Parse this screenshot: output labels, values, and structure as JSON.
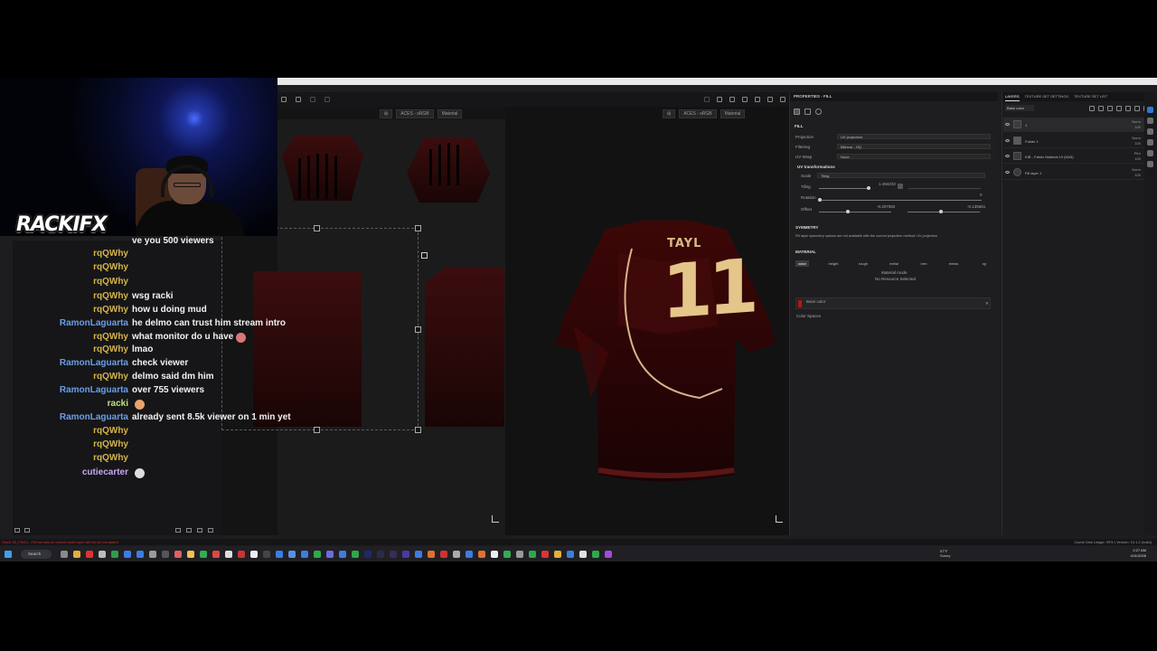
{
  "app": {
    "viewports": {
      "left": {
        "colorspace": "ACES - sRGB",
        "mode": "Material"
      },
      "right": {
        "colorspace": "ACES - sRGB",
        "mode": "Material"
      }
    },
    "properties": {
      "title": "PROPERTIES - FILL",
      "section_fill": "FILL",
      "projection_label": "Projection",
      "projection_value": "UV projection",
      "filtering_label": "Filtering",
      "filtering_value": "Bilinear - HQ",
      "uvwrap_label": "UV Wrap",
      "uvwrap_value": "None",
      "uvtrans_label": "UV transformations",
      "scale_label": "Scale",
      "scale_value": "Tiling",
      "tiling_label": "Tiling",
      "tiling_value": "1.494233",
      "rotation_label": "Rotation",
      "rotation_value": "0",
      "offset_label": "Offset",
      "offset_x": "-0.207082",
      "offset_y": "-0.135661",
      "symmetry_label": "SYMMETRY",
      "symmetry_note": "Fill layer symmetry options are not available with the current projection method: UV projection",
      "material_label": "MATERIAL",
      "channels": [
        "color",
        "height",
        "rough",
        "metal",
        "nrm",
        "emiss",
        "op"
      ],
      "material_mode_label": "Material mode",
      "material_mode_value": "No Resource Selected",
      "base_color_label": "Base color",
      "color_spaces_label": "Color Spaces"
    },
    "layers": {
      "tabs": [
        "LAYERS",
        "TEXTURE SET SETTINGS",
        "TEXTURE SET LIST"
      ],
      "blend_dropdown": "Base color",
      "items": [
        {
          "name": "1",
          "blend": "Norm",
          "opacity": "100"
        },
        {
          "name": "Folder 1",
          "blend": "Norm",
          "opacity": "100"
        },
        {
          "name": "KIB - Fabric Material 19 (M43)",
          "blend": "Pthr",
          "opacity": "100"
        },
        {
          "name": "Fill layer 1",
          "blend": "Norm",
          "opacity": "100"
        }
      ]
    },
    "status": {
      "error": "Stack 1B_FW13 - Fill normals on mixed mode layer will not be computed",
      "version": "Cache Disk Usage: 99% | Version: 10.1.2 (build)"
    }
  },
  "taskbar": {
    "search": "Search",
    "weather_temp": "57°F",
    "weather_desc": "Sunny",
    "time": "2:27 AM",
    "date": "4/11/2026"
  },
  "overlay": {
    "logo": "RACKIFX",
    "chat": [
      {
        "user": "",
        "text": "ve you 500 viewers",
        "color": "#ffffff"
      },
      {
        "user": "rqQWhy",
        "text": "",
        "color": "#d4b44a"
      },
      {
        "user": "rqQWhy",
        "text": "",
        "color": "#d4b44a"
      },
      {
        "user": "rqQWhy",
        "text": "",
        "color": "#d4b44a"
      },
      {
        "user": "rqQWhy",
        "text": "wsg racki",
        "color": "#d4b44a"
      },
      {
        "user": "rqQWhy",
        "text": "how u doing mud",
        "color": "#d4b44a"
      },
      {
        "user": "RamonLaguarta",
        "text": "he delmo can trust him stream intro",
        "color": "#6a9fe8"
      },
      {
        "user": "rqQWhy",
        "text": "what monitor do u have",
        "color": "#d4b44a"
      },
      {
        "user": "rqQWhy",
        "text": "lmao",
        "color": "#d4b44a"
      },
      {
        "user": "RamonLaguarta",
        "text": "check viewer",
        "color": "#6a9fe8"
      },
      {
        "user": "rqQWhy",
        "text": "delmo said dm him",
        "color": "#d4b44a"
      },
      {
        "user": "RamonLaguarta",
        "text": "over 755 viewers",
        "color": "#6a9fe8"
      },
      {
        "user": "racki",
        "text": "",
        "color": "#c0e07a"
      },
      {
        "user": "RamonLaguarta",
        "text": "already sent 8.5k viewer on 1 min yet",
        "color": "#6a9fe8"
      },
      {
        "user": "rqQWhy",
        "text": "",
        "color": "#d4b44a"
      },
      {
        "user": "rqQWhy",
        "text": "",
        "color": "#d4b44a"
      },
      {
        "user": "rqQWhy",
        "text": "",
        "color": "#d4b44a"
      },
      {
        "user": "cutiecarter",
        "text": "",
        "color": "#c8a6f2"
      }
    ]
  },
  "shirt": {
    "number": "11",
    "name_text": "TAYL"
  }
}
